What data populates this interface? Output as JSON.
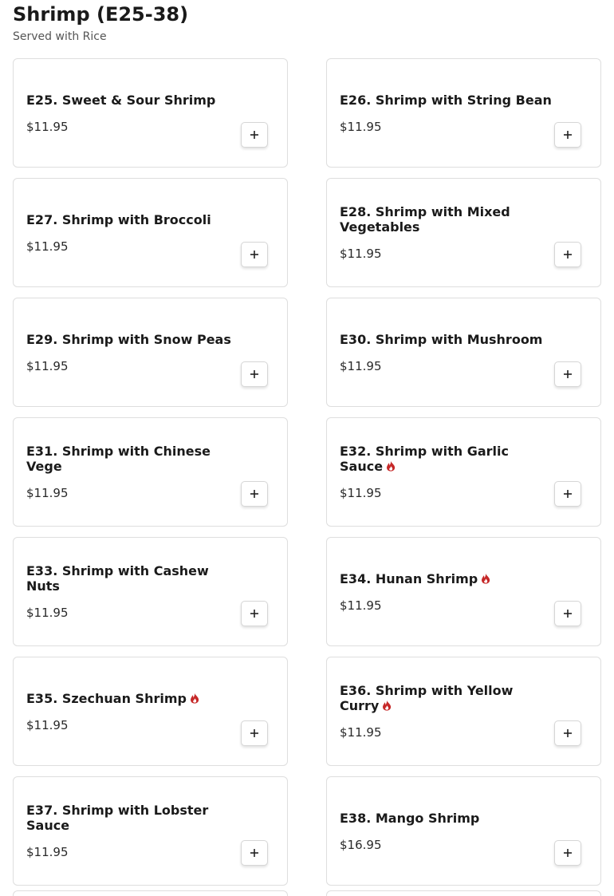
{
  "section": {
    "title": "Shrimp (E25-38)",
    "subtitle": "Served with Rice"
  },
  "items": [
    {
      "name": "E25. Sweet & Sour Shrimp",
      "price": "$11.95",
      "spicy": false
    },
    {
      "name": "E26. Shrimp with String Bean",
      "price": "$11.95",
      "spicy": false
    },
    {
      "name": "E27. Shrimp with Broccoli",
      "price": "$11.95",
      "spicy": false
    },
    {
      "name": "E28. Shrimp with Mixed Vegetables",
      "price": "$11.95",
      "spicy": false
    },
    {
      "name": "E29. Shrimp with Snow Peas",
      "price": "$11.95",
      "spicy": false
    },
    {
      "name": "E30. Shrimp with Mushroom",
      "price": "$11.95",
      "spicy": false
    },
    {
      "name": "E31. Shrimp with Chinese Vege",
      "price": "$11.95",
      "spicy": false
    },
    {
      "name": "E32. Shrimp with Garlic Sauce",
      "price": "$11.95",
      "spicy": true
    },
    {
      "name": "E33. Shrimp with Cashew Nuts",
      "price": "$11.95",
      "spicy": false
    },
    {
      "name": "E34. Hunan Shrimp",
      "price": "$11.95",
      "spicy": true
    },
    {
      "name": "E35. Szechuan Shrimp",
      "price": "$11.95",
      "spicy": true
    },
    {
      "name": "E36. Shrimp with Yellow Curry",
      "price": "$11.95",
      "spicy": true
    },
    {
      "name": "E37. Shrimp with Lobster Sauce",
      "price": "$11.95",
      "spicy": false
    },
    {
      "name": "E38. Mango Shrimp",
      "price": "$16.95",
      "spicy": false
    }
  ],
  "icons": {
    "spicy": "flame-icon",
    "add": "plus-icon"
  },
  "colors": {
    "spicy": "#c62828",
    "text": "#1a1a1a",
    "border": "#dedede"
  }
}
